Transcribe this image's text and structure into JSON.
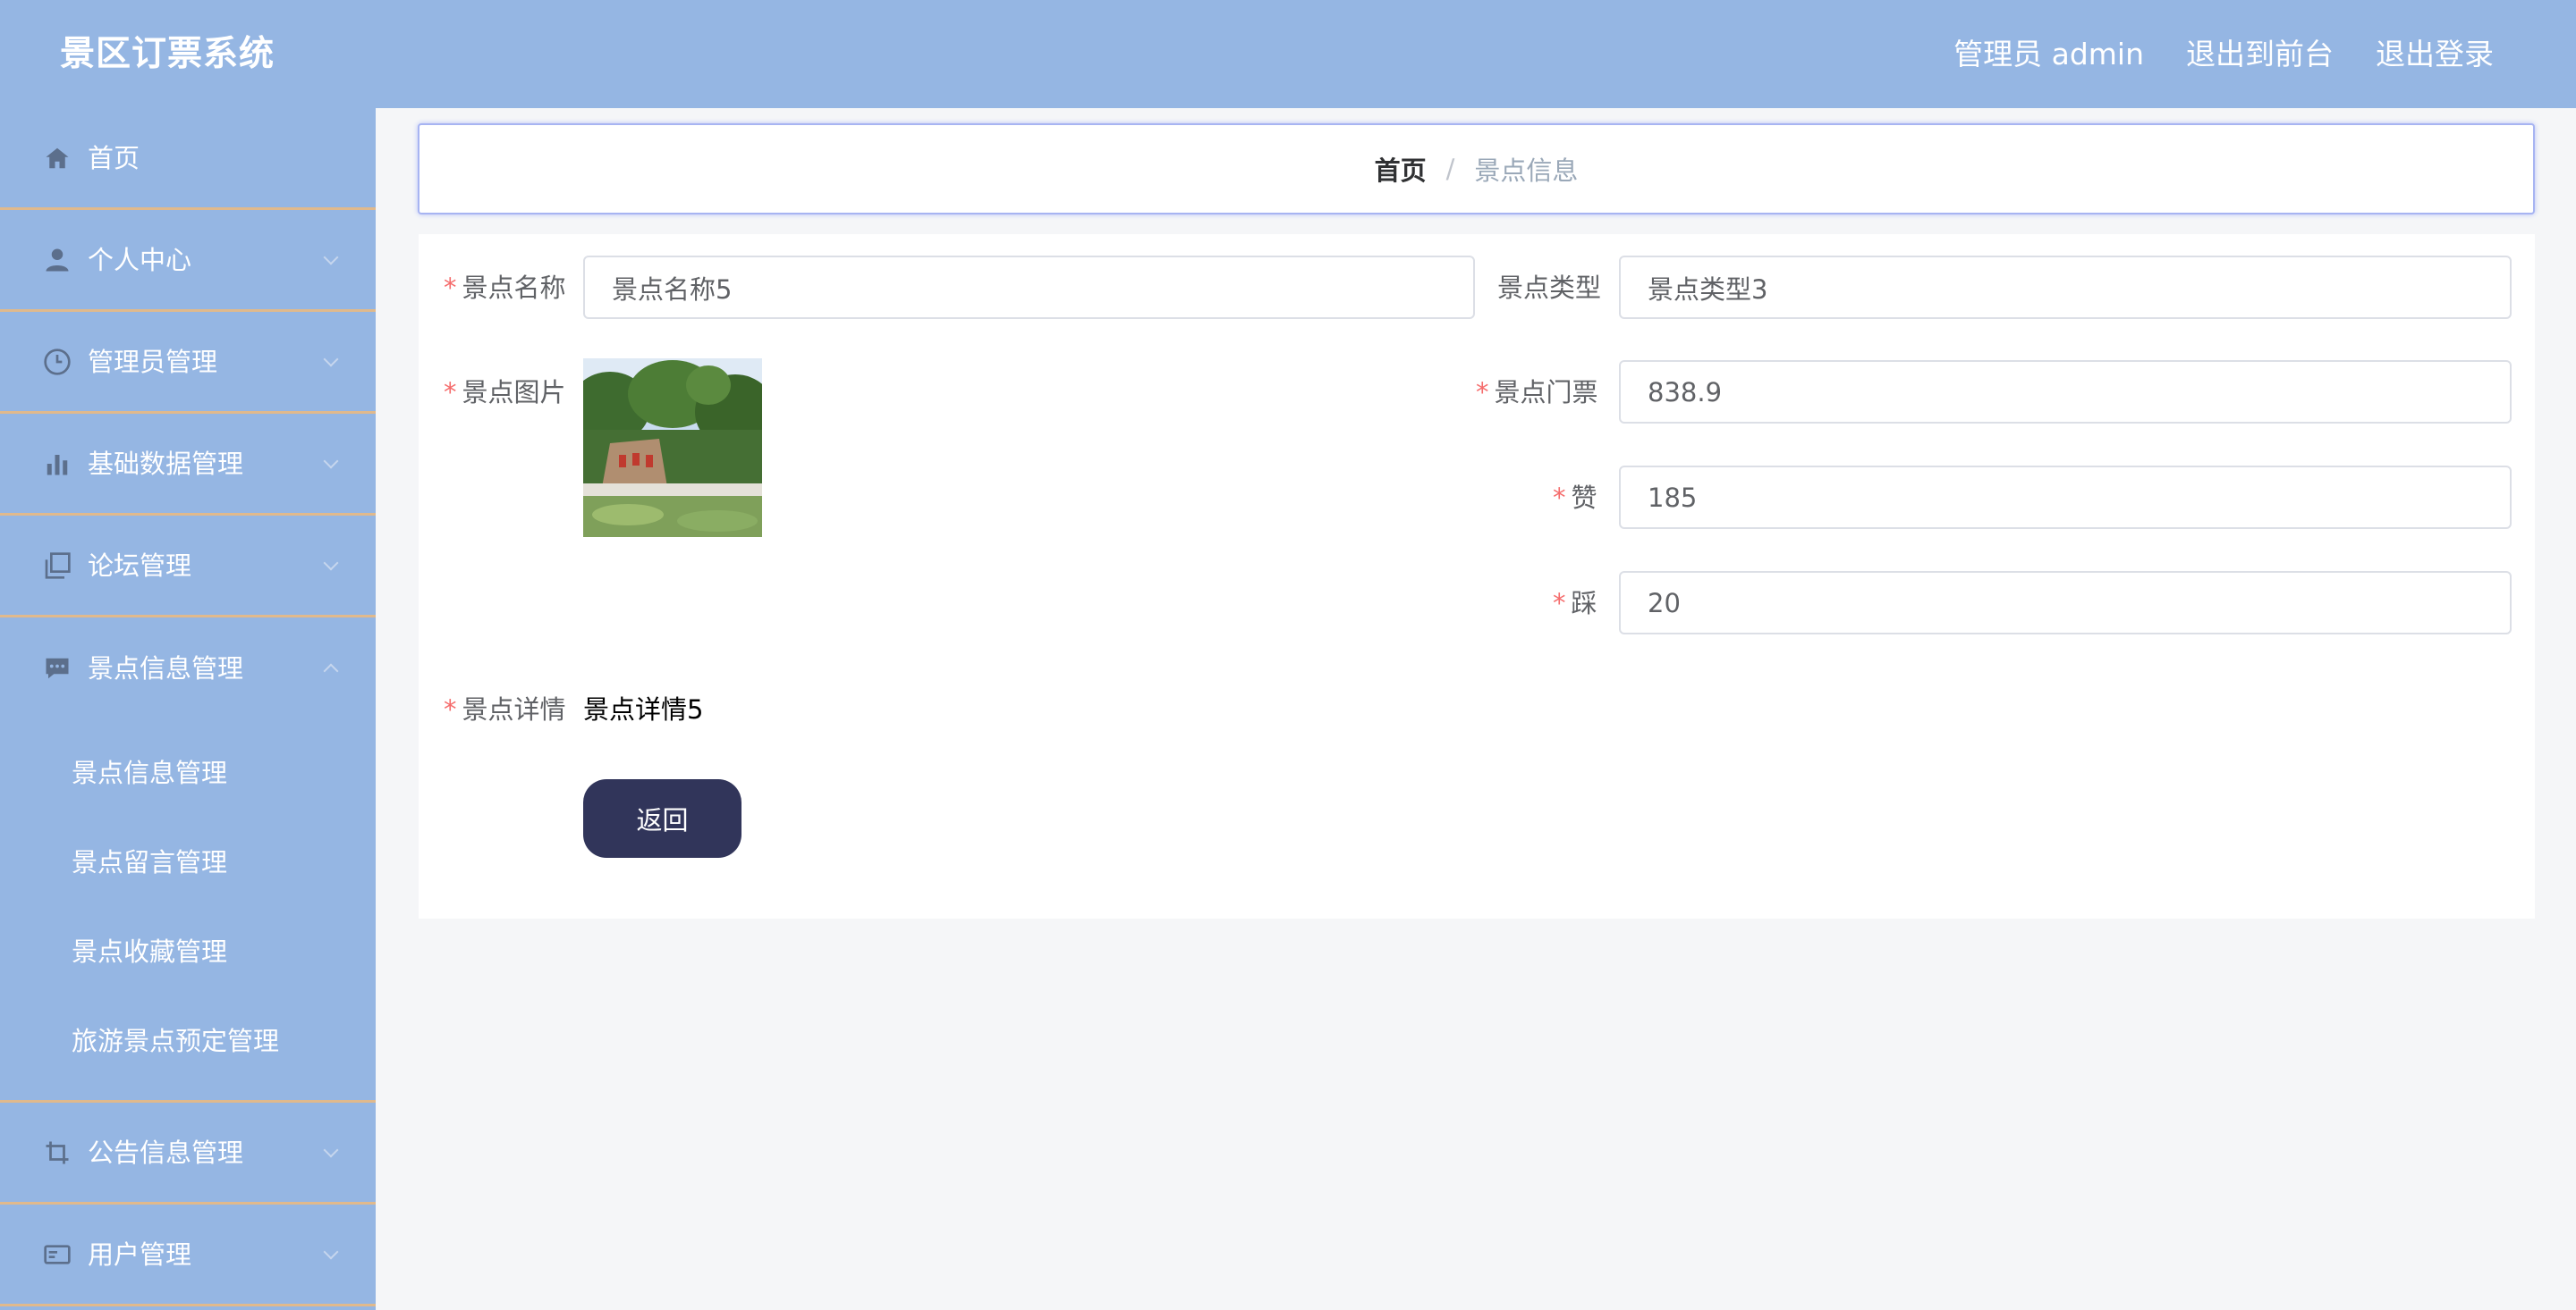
{
  "header": {
    "app_title": "景区订票系统",
    "admin_label": "管理员 admin",
    "exit_front_label": "退出到前台",
    "logout_label": "退出登录"
  },
  "sidebar": {
    "items": [
      {
        "label": "首页",
        "icon": "home-icon"
      },
      {
        "label": "个人中心",
        "icon": "user-icon"
      },
      {
        "label": "管理员管理",
        "icon": "clock-icon"
      },
      {
        "label": "基础数据管理",
        "icon": "bar-chart-icon"
      },
      {
        "label": "论坛管理",
        "icon": "copy-icon"
      },
      {
        "label": "景点信息管理",
        "icon": "chat-icon"
      },
      {
        "label": "公告信息管理",
        "icon": "crop-icon"
      },
      {
        "label": "用户管理",
        "icon": "card-icon"
      }
    ],
    "submenu": [
      "景点信息管理",
      "景点留言管理",
      "景点收藏管理",
      "旅游景点预定管理"
    ]
  },
  "breadcrumb": {
    "home": "首页",
    "separator": "/",
    "current": "景点信息"
  },
  "form": {
    "name_label": "景点名称",
    "name_value": "景点名称5",
    "type_label": "景点类型",
    "type_value": "景点类型3",
    "image_label": "景点图片",
    "price_label": "景点门票",
    "price_value": "838.9",
    "like_label": "赞",
    "like_value": "185",
    "dislike_label": "踩",
    "dislike_value": "20",
    "detail_label": "景点详情",
    "detail_value": "景点详情5",
    "required_mark": "*",
    "back_button": "返回"
  },
  "colors": {
    "header_bg": "#95b6e3",
    "sidebar_bg": "#95b6e3",
    "menu_divider": "#e0b98c",
    "button_bg": "#31355a",
    "required": "#f56c6c"
  }
}
